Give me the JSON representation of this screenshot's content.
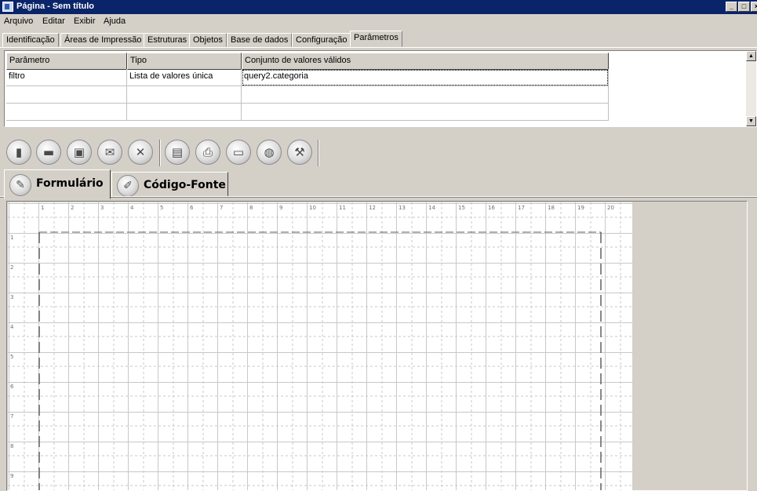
{
  "window": {
    "title": "Página - Sem título",
    "btn_min": "_",
    "btn_max": "□",
    "btn_close": "×"
  },
  "menu": {
    "items": [
      "Arquivo",
      "Editar",
      "Exibir",
      "Ajuda"
    ]
  },
  "tabs": [
    "Identificação",
    "Áreas de Impressão",
    "Estruturas",
    "Objetos",
    "Base de dados",
    "Configuração",
    "Parâmetros"
  ],
  "active_tab": "Parâmetros",
  "params_table": {
    "headers": [
      "Parâmetro",
      "Tipo",
      "Conjunto de valores válidos"
    ],
    "rows": [
      [
        "filtro",
        "Lista de valores única",
        "query2.categoria"
      ]
    ]
  },
  "toolbar": {
    "buttons": [
      "new-document-icon",
      "open-folder-icon",
      "save-icon",
      "email-icon",
      "delete-icon",
      "print-preview-icon",
      "print-icon",
      "monitor-icon",
      "globe-icon",
      "build-hammer-icon"
    ]
  },
  "view_tabs": {
    "form": "Formulário",
    "source": "Código-Fonte"
  },
  "ruler": {
    "top": [
      "1",
      "2",
      "3",
      "4",
      "5",
      "6",
      "7",
      "8",
      "9",
      "10",
      "11",
      "12",
      "13",
      "14",
      "15",
      "16",
      "17",
      "18",
      "19",
      "20"
    ],
    "left": [
      "1",
      "2",
      "3",
      "4",
      "5",
      "6",
      "7",
      "8",
      "9"
    ]
  },
  "colors": {
    "title_bar": "#0a246a",
    "window_bg": "#d4d0c8",
    "grid_line": "#c8c8c8"
  }
}
